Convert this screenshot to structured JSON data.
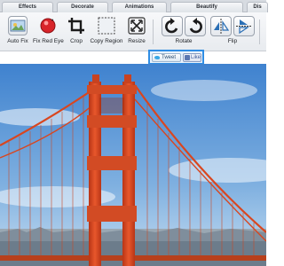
{
  "tabs": [
    "Effects",
    "Decorate",
    "Animations",
    "Beautify",
    "Dis"
  ],
  "tools": {
    "auto_fix": "Auto Fix",
    "fix_red_eye": "Fix Red Eye",
    "crop": "Crop",
    "copy_region": "Copy Region",
    "resize": "Resize",
    "rotate": "Rotate",
    "flip": "Flip"
  },
  "social": {
    "tweet": "Tweet",
    "like": "Like"
  },
  "colors": {
    "tab_bar": "#d7dbe1",
    "toolbar": "#eceff2",
    "share_border": "#2f8de4",
    "bridge": "#e2502a",
    "sky": "#5f9ad6"
  },
  "icons": {
    "auto_fix": "auto-fix-icon",
    "fix_red_eye": "red-eye-icon",
    "crop": "crop-icon",
    "copy_region": "copy-region-icon",
    "resize": "resize-icon",
    "rotate": "rotate-icons",
    "flip": "flip-icons",
    "tweet": "twitter-bird-icon",
    "like": "thumbs-up-icon"
  }
}
